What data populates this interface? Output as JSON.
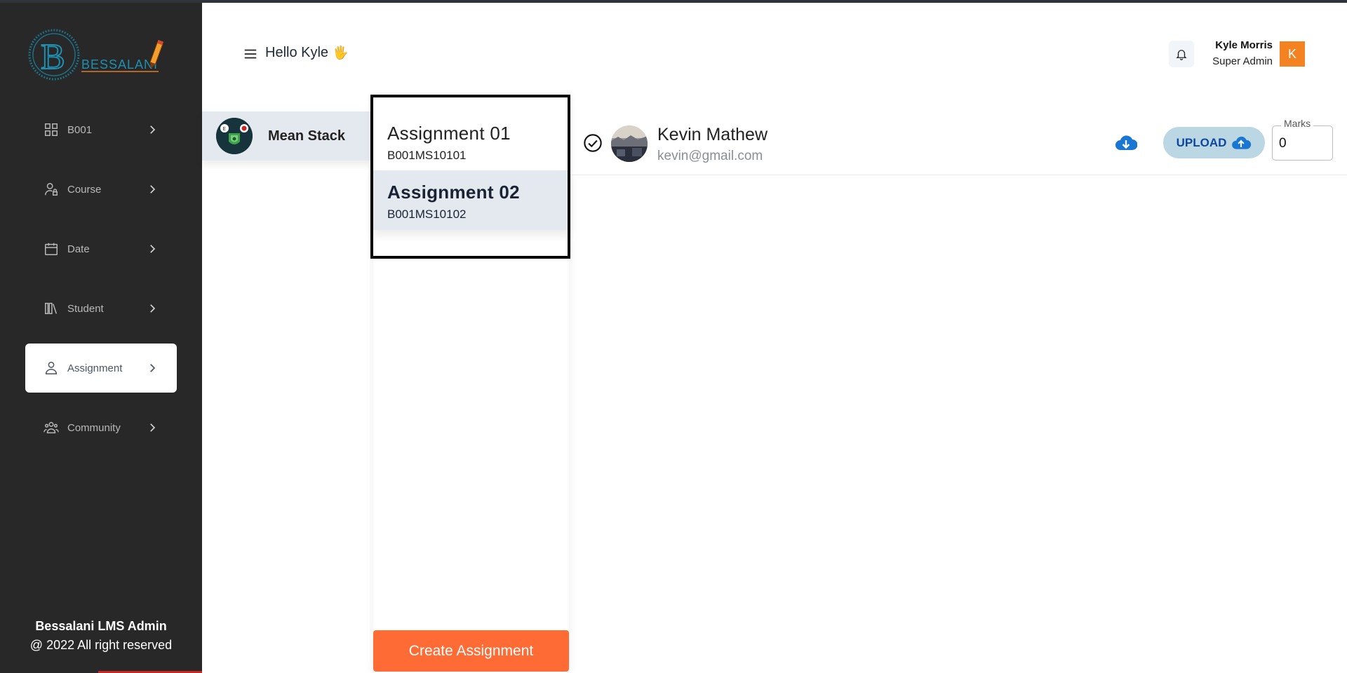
{
  "brand": {
    "logo_text": "BESSALANI"
  },
  "header": {
    "greeting": "Hello Kyle",
    "wave_emoji": "🖐",
    "user_name": "Kyle Morris",
    "user_role": "Super Admin",
    "avatar_initial": "K",
    "avatar_color": "#f58220"
  },
  "sidebar": {
    "items": [
      {
        "label": "B001",
        "icon": "grid-icon"
      },
      {
        "label": "Course",
        "icon": "user-lock-icon"
      },
      {
        "label": "Date",
        "icon": "calendar-icon"
      },
      {
        "label": "Student",
        "icon": "books-icon"
      },
      {
        "label": "Assignment",
        "icon": "user-icon",
        "active": true
      },
      {
        "label": "Community",
        "icon": "group-icon"
      }
    ],
    "footer_title": "Bessalani LMS Admin",
    "footer_copy": "@ 2022 All right reserved"
  },
  "course": {
    "label": "Mean Stack"
  },
  "assignments": [
    {
      "title": "Assignment  01",
      "code": "B001MS10101"
    },
    {
      "title": "Assignment  02",
      "code": "B001MS10102",
      "selected": true
    }
  ],
  "create_button": "Create Assignment",
  "student": {
    "name": "Kevin Mathew",
    "email": "kevin@gmail.com",
    "upload_label": "UPLOAD",
    "marks_label": "Marks",
    "marks_value": "0"
  },
  "colors": {
    "sidebar_bg": "#282828",
    "accent_orange": "#ff6b35",
    "upload_bg": "#bcd7e4",
    "upload_text": "#0d47a1",
    "selected_bg": "#e4e9ef"
  }
}
